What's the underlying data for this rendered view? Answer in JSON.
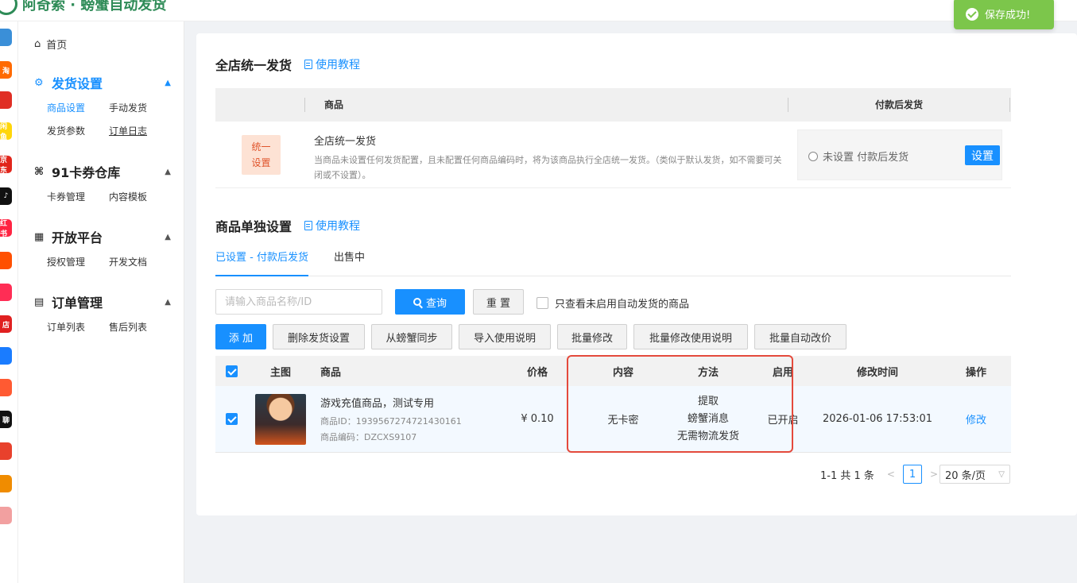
{
  "header": {
    "brand": "阿奇索 · 螃蟹自动发货"
  },
  "toast": {
    "text": "保存成功!"
  },
  "rail": [
    {
      "icon": "grid-app-icon",
      "text": "",
      "color": "#3a8fd8"
    },
    {
      "icon": "taobao-icon",
      "text": "淘",
      "color": "#ff6a00"
    },
    {
      "icon": "pinduoduo-icon",
      "text": "",
      "color": "#e02e24"
    },
    {
      "icon": "xianyu-icon",
      "text": "闲鱼",
      "color": "#ffd60a"
    },
    {
      "icon": "jd-icon",
      "text": "京东",
      "color": "#e1251b"
    },
    {
      "icon": "douyin-icon",
      "text": "♪",
      "color": "#111111"
    },
    {
      "icon": "xiaohongshu-icon",
      "text": "红书",
      "color": "#ff2442"
    },
    {
      "icon": "kuaishou-icon",
      "text": "",
      "color": "#ff5000"
    },
    {
      "icon": "like-app-icon",
      "text": "",
      "color": "#ff2d55"
    },
    {
      "icon": "shop-icon",
      "text": "店",
      "color": "#e02020"
    },
    {
      "icon": "swirl-app-icon",
      "text": "",
      "color": "#1a7cff"
    },
    {
      "icon": "chat-app-icon",
      "text": "",
      "color": "#ff5a32"
    },
    {
      "icon": "liao-app-icon",
      "text": "聊",
      "color": "#111111"
    },
    {
      "icon": "arrow-app-icon",
      "text": "",
      "color": "#e8412c"
    },
    {
      "icon": "crab-app-icon",
      "text": "",
      "color": "#f08c00"
    },
    {
      "icon": "clipboard-app-icon",
      "text": "",
      "color": "#f2a0a0"
    }
  ],
  "sidebar": {
    "home": "首页",
    "groups": [
      {
        "title": "发货设置",
        "items": [
          "商品设置",
          "手动发货",
          "发货参数",
          "订单日志"
        ]
      },
      {
        "title": "91卡券仓库",
        "items": [
          "卡券管理",
          "内容模板"
        ]
      },
      {
        "title": "开放平台",
        "items": [
          "授权管理",
          "开发文档"
        ]
      },
      {
        "title": "订单管理",
        "items": [
          "订单列表",
          "售后列表"
        ]
      }
    ]
  },
  "unified": {
    "title": "全店统一发货",
    "tutorial": "使用教程",
    "col_goods": "商品",
    "col_after_pay": "付款后发货",
    "badge_line1": "统一",
    "badge_line2": "设置",
    "item_title": "全店统一发货",
    "item_desc": "当商品未设置任何发货配置，且未配置任何商品编码时，将为该商品执行全店统一发货。（类似于默认发货，如不需要可关闭或不设置）。",
    "radio_label": "未设置 付款后发货",
    "set_button": "设置"
  },
  "single": {
    "title": "商品单独设置",
    "tutorial": "使用教程",
    "tabs": [
      "已设置 - 付款后发货",
      "出售中"
    ],
    "search_placeholder": "请输入商品名称/ID",
    "query_button": "查询",
    "reset_button": "重 置",
    "only_disabled_label": "只查看未启用自动发货的商品",
    "actions": [
      "添 加",
      "删除发货设置",
      "从螃蟹同步",
      "导入使用说明",
      "批量修改",
      "批量修改使用说明",
      "批量自动改价"
    ],
    "columns": {
      "image": "主图",
      "goods": "商品",
      "price": "价格",
      "content": "内容",
      "method": "方法",
      "enabled": "启用",
      "modified": "修改时间",
      "action": "操作"
    },
    "rows": [
      {
        "name": "游戏充值商品，测试专用",
        "goods_id": "商品ID：1939567274721430161",
        "goods_code": "商品编码：DZCXS9107",
        "price": "¥ 0.10",
        "content": "无卡密",
        "method_lines": [
          "提取",
          "螃蟹消息",
          "无需物流发货"
        ],
        "enabled": "已开启",
        "modified": "2026-01-06 17:53:01",
        "action": "修改"
      }
    ],
    "pagination": {
      "summary": "1-1 共 1 条",
      "current_page": "1",
      "page_size": "20 条/页"
    }
  }
}
